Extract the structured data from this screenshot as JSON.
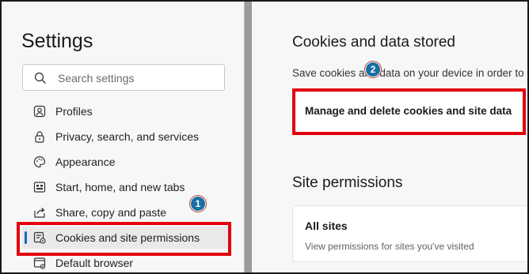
{
  "sidebar": {
    "title": "Settings",
    "search_placeholder": "Search settings",
    "items": [
      {
        "label": "Profiles",
        "icon": "profile-icon"
      },
      {
        "label": "Privacy, search, and services",
        "icon": "lock-icon"
      },
      {
        "label": "Appearance",
        "icon": "palette-icon"
      },
      {
        "label": "Start, home, and new tabs",
        "icon": "start-page-icon"
      },
      {
        "label": "Share, copy and paste",
        "icon": "share-icon"
      },
      {
        "label": "Cookies and site permissions",
        "icon": "cookie-permissions-icon",
        "active": true
      },
      {
        "label": "Default browser",
        "icon": "browser-icon"
      }
    ]
  },
  "main": {
    "cookies_heading": "Cookies and data stored",
    "save_text": "Save cookies and data on your device in order to",
    "manage_label": "Manage and delete cookies and site data",
    "site_permissions_heading": "Site permissions",
    "all_sites_title": "All sites",
    "all_sites_desc": "View permissions for sites you've visited"
  },
  "annotations": {
    "step1": "1",
    "step2": "2"
  },
  "colors": {
    "highlight_red": "#e3000f",
    "badge_blue": "#1a6ea6",
    "active_accent": "#0f6cbd"
  }
}
